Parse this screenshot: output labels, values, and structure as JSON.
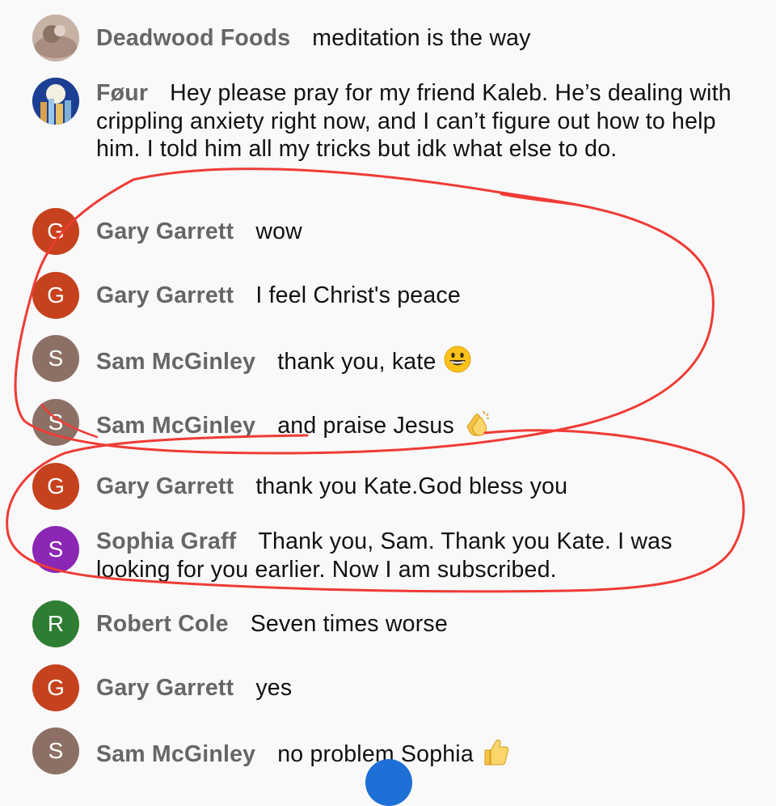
{
  "messages": [
    {
      "author": "Deadwood Foods",
      "text": "meditation is the way",
      "avatar": {
        "type": "photo",
        "icon": "photo-avatar-icon"
      }
    },
    {
      "author": "Føur",
      "text": "Hey please pray for my friend Kaleb. He’s dealing with crippling anxiety right now, and I can’t figure out how to help him. I told him all my tricks but idk what else to do.",
      "avatar": {
        "type": "photo",
        "icon": "city-night-avatar-icon"
      }
    },
    {
      "author": "Gary Garrett",
      "text": "wow",
      "avatar": {
        "type": "letter",
        "letter": "G",
        "color": "#c6411d"
      }
    },
    {
      "author": "Gary Garrett",
      "text": "I feel Christ's peace",
      "avatar": {
        "type": "letter",
        "letter": "G",
        "color": "#c6411d"
      }
    },
    {
      "author": "Sam McGinley",
      "text": "thank you, kate",
      "emoji": "grinning-face-emoji",
      "avatar": {
        "type": "letter",
        "letter": "S",
        "color": "#8d7065"
      }
    },
    {
      "author": "Sam McGinley",
      "text": "and praise Jesus",
      "emoji": "clapping-hands-emoji",
      "avatar": {
        "type": "letter",
        "letter": "S",
        "color": "#8d7065"
      }
    },
    {
      "author": "Gary Garrett",
      "text": "thank you Kate.God bless you",
      "avatar": {
        "type": "letter",
        "letter": "G",
        "color": "#c6411d"
      }
    },
    {
      "author": "Sophia Graff",
      "text": "Thank you, Sam. Thank you Kate. I was looking for you earlier. Now I am subscribed.",
      "avatar": {
        "type": "letter",
        "letter": "S",
        "color": "#8b27b4"
      }
    },
    {
      "author": "Robert Cole",
      "text": "Seven times worse",
      "avatar": {
        "type": "letter",
        "letter": "R",
        "color": "#2e7d32"
      }
    },
    {
      "author": "Gary Garrett",
      "text": "yes",
      "avatar": {
        "type": "letter",
        "letter": "G",
        "color": "#c6411d"
      }
    },
    {
      "author": "Sam McGinley",
      "text": "no problem Sophia",
      "emoji": "thumbs-up-emoji",
      "avatar": {
        "type": "letter",
        "letter": "S",
        "color": "#8d7065"
      }
    }
  ],
  "annotation": {
    "color": "#ef3b35",
    "shape": "hand-drawn circles"
  },
  "fab_color": "#1e6fd6"
}
